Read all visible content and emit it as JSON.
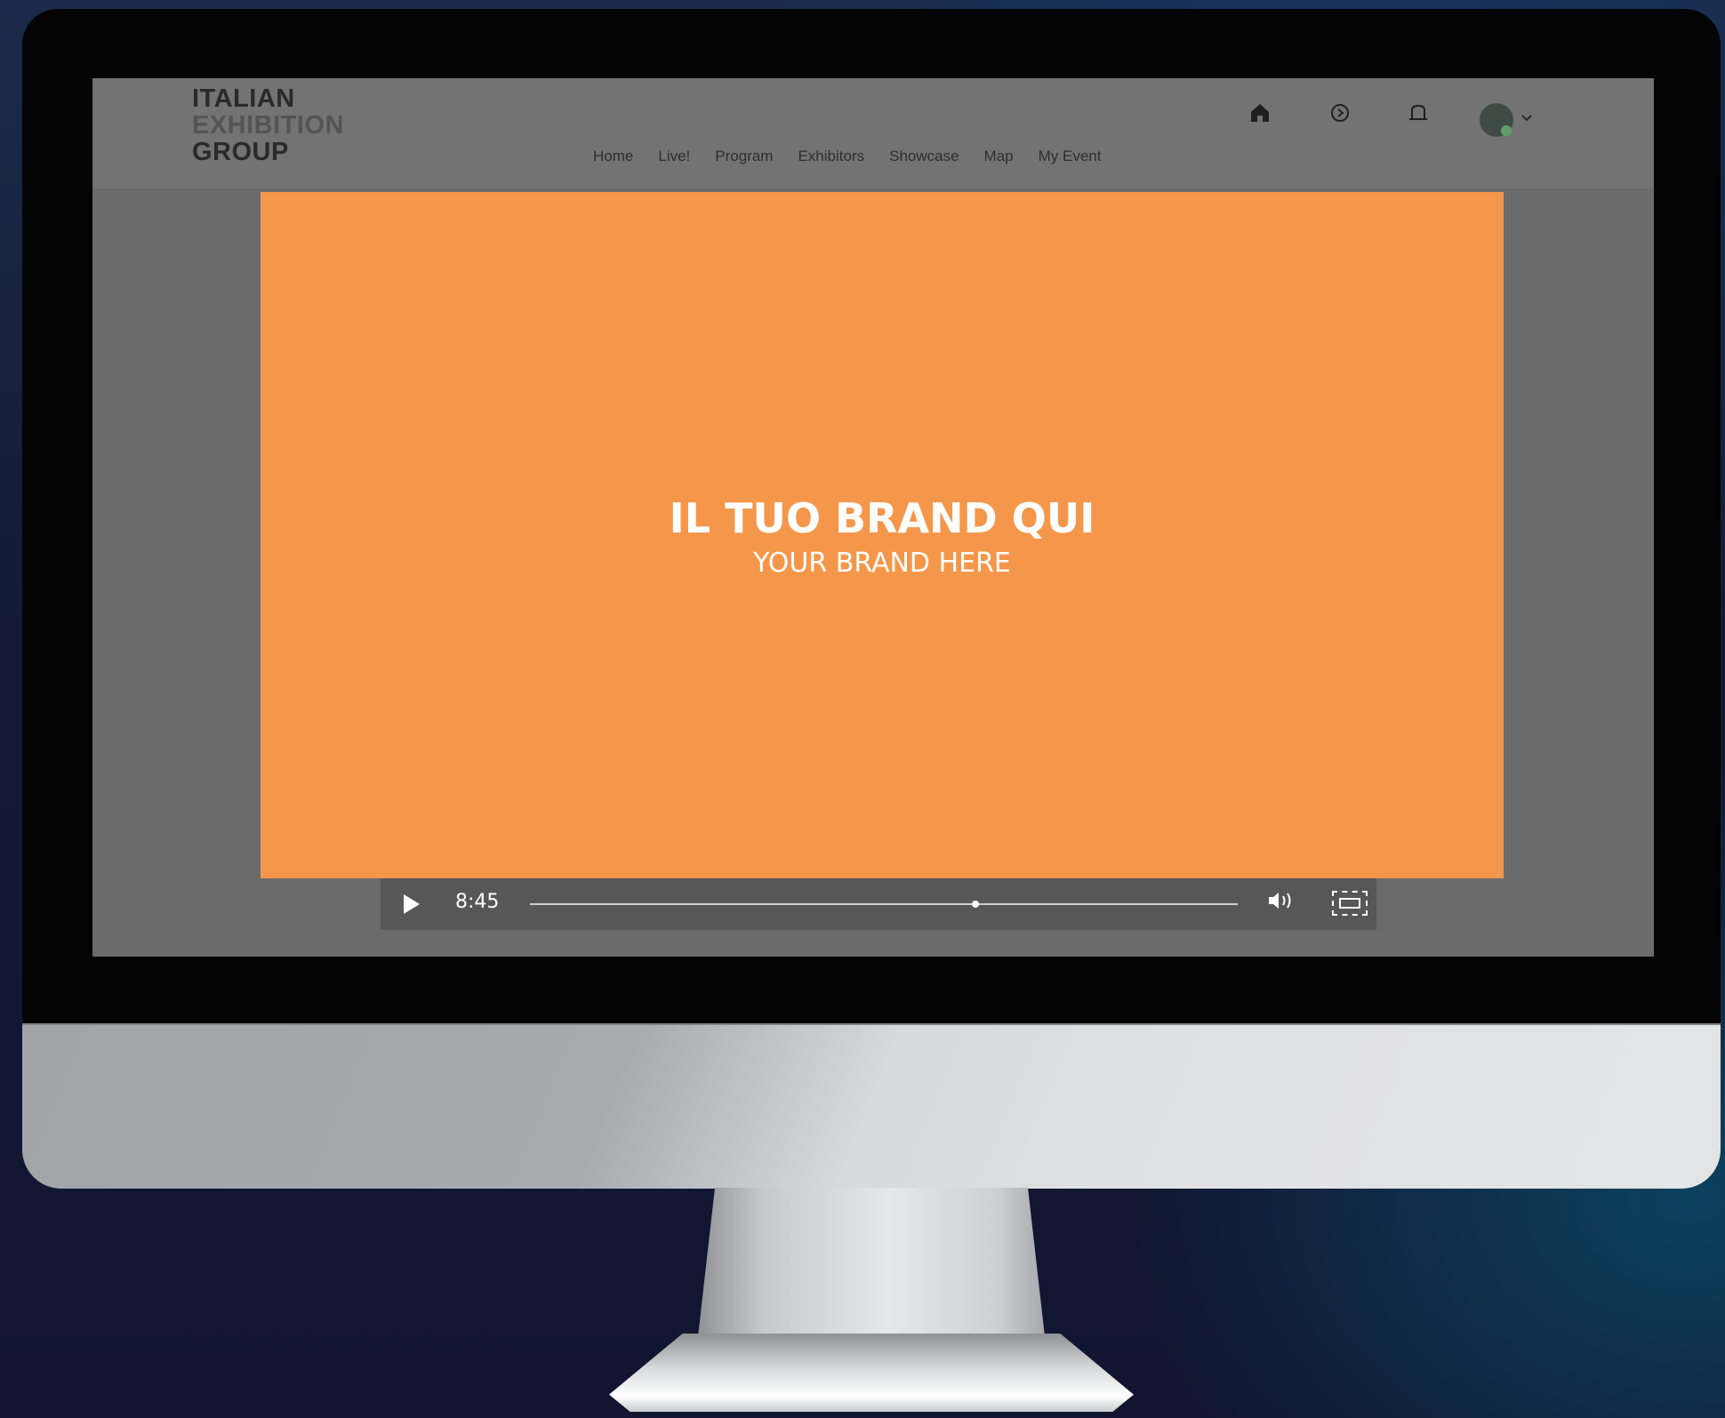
{
  "logo": {
    "line1": "ITALIAN",
    "line2": "EXHIBITION",
    "line3": "GROUP"
  },
  "nav": {
    "items": [
      "Home",
      "Live!",
      "Program",
      "Exhibitors",
      "Showcase",
      "Map",
      "My Event"
    ]
  },
  "header_icons": [
    "home-icon",
    "chat-icon",
    "bell-icon",
    "avatar",
    "chevron-down-icon"
  ],
  "video": {
    "title": "IL TUO BRAND QUI",
    "subtitle": "YOUR BRAND HERE",
    "background_color": "#f5974a",
    "time": "8:45",
    "progress": 0.63
  },
  "colors": {
    "accent": "#f5974a",
    "screen_bg": "#6b6b6b",
    "header_bg": "#737373",
    "controls_bg": "#575757"
  }
}
